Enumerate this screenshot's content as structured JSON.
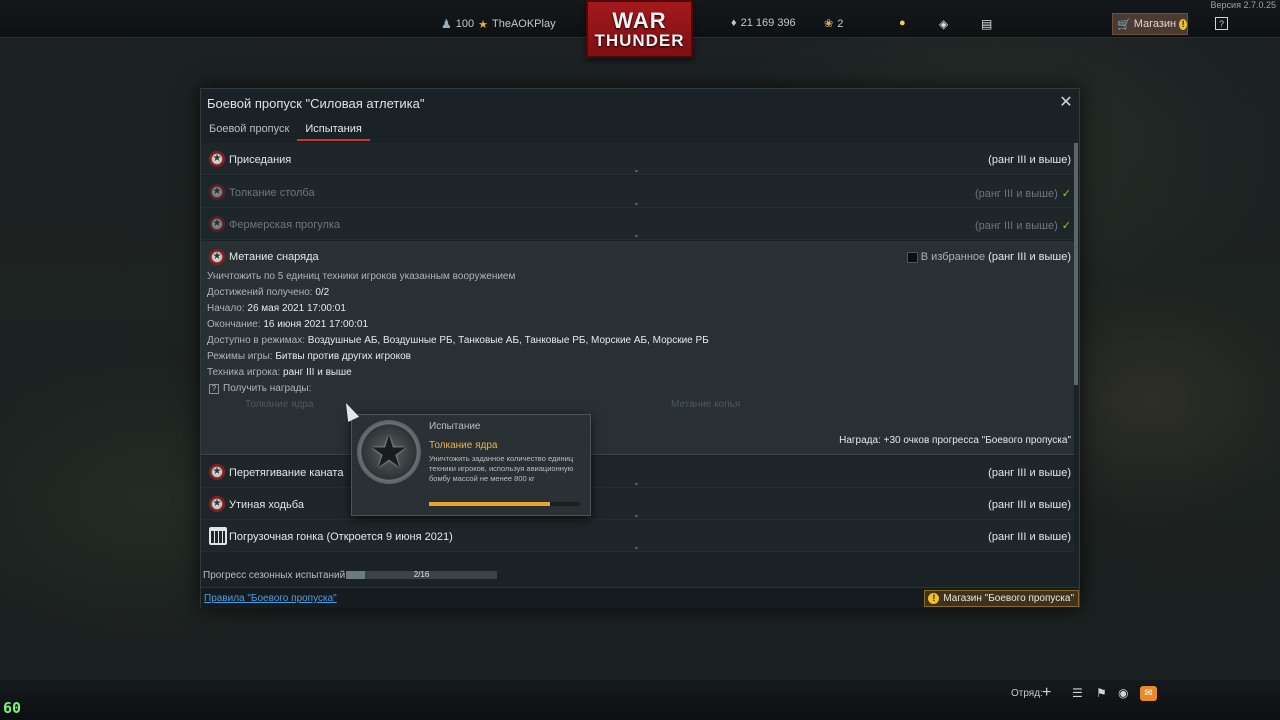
{
  "top": {
    "version": "Версия 2.7.0.25",
    "level": "100",
    "player": "TheAOKPlay",
    "silver": "21 169 396",
    "eagles": "2",
    "shop": "Магазин",
    "logo_top": "WAR",
    "logo_bottom": "THUNDER"
  },
  "window": {
    "title": "Боевой пропуск \"Силовая атлетика\"",
    "tabs": [
      "Боевой пропуск",
      "Испытания"
    ]
  },
  "challenges": [
    {
      "name": "Приседания",
      "rank": "(ранг III и выше)",
      "done": false
    },
    {
      "name": "Толкание столба",
      "rank": "(ранг III и выше)",
      "done": true
    },
    {
      "name": "Фермерская прогулка",
      "rank": "(ранг III и выше)",
      "done": true
    },
    {
      "name": "Перетягивание каната",
      "rank": "(ранг III и выше)",
      "done": false
    },
    {
      "name": "Утиная ходьба",
      "rank": "(ранг III и выше)",
      "done": false
    },
    {
      "name": "Погрузочная гонка (Откроется 9 июня 2021)",
      "rank": "(ранг III и выше)",
      "done": false
    }
  ],
  "expanded": {
    "name": "Метание снаряда",
    "favorite": "В избранное",
    "rank": "(ранг III и выше)",
    "desc": "Уничтожить по 5 единиц техники игроков указанным вооружением",
    "achv_label": "Достижений получено:",
    "achv_value": "0/2",
    "start_label": "Начало:",
    "start_value": "26 мая 2021 17:00:01",
    "end_label": "Окончание:",
    "end_value": "16 июня 2021 17:00:01",
    "modes_label": "Доступно в режимах:",
    "modes_value": "Воздушные АБ, Воздушные РБ, Танковые АБ, Танковые РБ, Морские АБ, Морские РБ",
    "gm_label": "Режимы игры:",
    "gm_value": "Битвы против других игроков",
    "veh_label": "Техника игрока:",
    "veh_value": "ранг III и выше",
    "rewards": "Получить награды:",
    "sub1": "Толкание ядра",
    "sub2": "Метание копья",
    "reward": "Награда: +30 очков прогресса \"Боевого пропуска\""
  },
  "tooltip": {
    "header": "Испытание",
    "title": "Толкание ядра",
    "desc": "Уничтожить заданное количество единиц техники игроков, используя авиационную бомбу массой не менее 800 кг",
    "progress": 0.8
  },
  "progress": {
    "label": "Прогресс сезонных испытаний:",
    "value": "2/16",
    "fraction": 0.125
  },
  "footer": {
    "rules": "Правила \"Боевого пропуска\"",
    "shop": "Магазин \"Боевого пропуска\""
  },
  "bottom": {
    "squad": "Отряд:",
    "fps": "60"
  }
}
